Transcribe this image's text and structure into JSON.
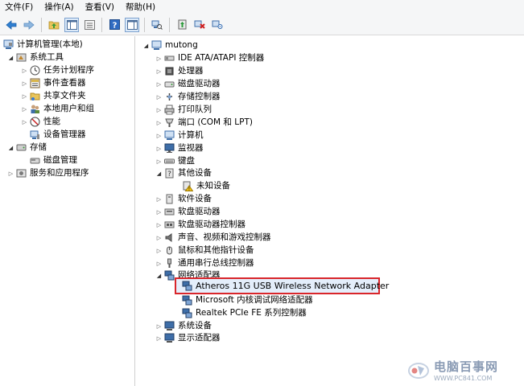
{
  "menubar": {
    "items": [
      "文件(F)",
      "操作(A)",
      "查看(V)",
      "帮助(H)"
    ]
  },
  "toolbar": {
    "buttons": [
      "back-arrow-icon",
      "forward-arrow-icon",
      "up-folder-icon",
      "show-hide-tree-icon",
      "properties-icon",
      "help-icon",
      "action-pane-icon",
      "scan-hardware-icon",
      "update-driver-icon",
      "disable-device-icon",
      "uninstall-icon"
    ]
  },
  "left_tree": {
    "root": "计算机管理(本地)",
    "system_tools": "系统工具",
    "task_scheduler": "任务计划程序",
    "event_viewer": "事件查看器",
    "shared_folders": "共享文件夹",
    "local_users": "本地用户和组",
    "performance": "性能",
    "device_manager": "设备管理器",
    "storage": "存储",
    "disk_management": "磁盘管理",
    "services_apps": "服务和应用程序"
  },
  "device_tree": {
    "computer_name": "mutong",
    "items": [
      "IDE ATA/ATAPI 控制器",
      "处理器",
      "磁盘驱动器",
      "存储控制器",
      "打印队列",
      "端口 (COM 和 LPT)",
      "计算机",
      "监视器",
      "键盘",
      "其他设备",
      "未知设备",
      "软件设备",
      "软盘驱动器",
      "软盘驱动器控制器",
      "声音、视频和游戏控制器",
      "鼠标和其他指针设备",
      "通用串行总线控制器",
      "网络适配器",
      "Atheros 11G USB Wireless Network Adapter",
      "Microsoft 内核调试网络适配器",
      "Realtek PCIe FE 系列控制器",
      "系统设备",
      "显示适配器"
    ]
  },
  "watermark": {
    "name": "电脑百事网",
    "url": "WWW.PC841.COM"
  },
  "colors": {
    "selection_border": "#d9262b",
    "selection_fill": "#e4eefb",
    "toolbar_bg": "#f5f6f7"
  }
}
